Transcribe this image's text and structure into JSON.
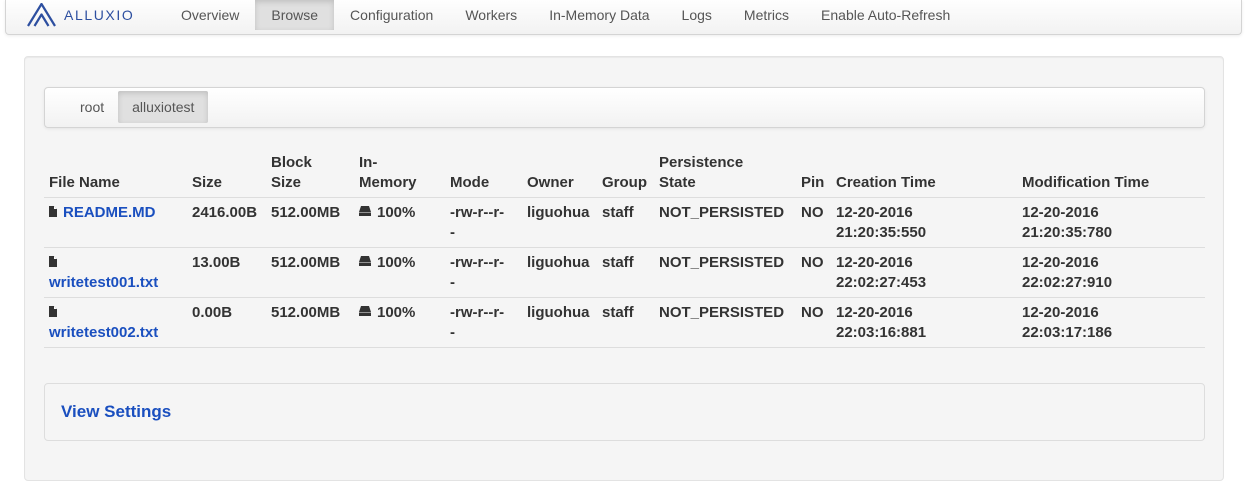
{
  "brand": {
    "name": "ALLUXIO"
  },
  "nav": {
    "items": [
      "Overview",
      "Browse",
      "Configuration",
      "Workers",
      "In-Memory Data",
      "Logs",
      "Metrics",
      "Enable Auto-Refresh"
    ],
    "active": "Browse"
  },
  "breadcrumbs": [
    "root",
    "alluxiotest"
  ],
  "table": {
    "headers": {
      "file_name": "File Name",
      "size": "Size",
      "block_size_1": "Block",
      "block_size_2": "Size",
      "in_memory_1": "In-",
      "in_memory_2": "Memory",
      "mode": "Mode",
      "owner": "Owner",
      "group": "Group",
      "persistence_1": "Persistence",
      "persistence_2": "State",
      "pin": "Pin",
      "creation_time": "Creation Time",
      "modification_time": "Modification Time"
    },
    "rows": [
      {
        "name": "README.MD",
        "size": "2416.00B",
        "block_size": "512.00MB",
        "in_memory": "100%",
        "mode_1": "-rw-r--r-",
        "mode_2": "-",
        "owner": "liguohua",
        "group": "staff",
        "persistence": "NOT_PERSISTED",
        "pin": "NO",
        "created_date": "12-20-2016",
        "created_time": "21:20:35:550",
        "modified_date": "12-20-2016",
        "modified_time": "21:20:35:780"
      },
      {
        "name": "writetest001.txt",
        "size": "13.00B",
        "block_size": "512.00MB",
        "in_memory": "100%",
        "mode_1": "-rw-r--r-",
        "mode_2": "-",
        "owner": "liguohua",
        "group": "staff",
        "persistence": "NOT_PERSISTED",
        "pin": "NO",
        "created_date": "12-20-2016",
        "created_time": "22:02:27:453",
        "modified_date": "12-20-2016",
        "modified_time": "22:02:27:910"
      },
      {
        "name": "writetest002.txt",
        "size": "0.00B",
        "block_size": "512.00MB",
        "in_memory": "100%",
        "mode_1": "-rw-r--r-",
        "mode_2": "-",
        "owner": "liguohua",
        "group": "staff",
        "persistence": "NOT_PERSISTED",
        "pin": "NO",
        "created_date": "12-20-2016",
        "created_time": "22:03:16:881",
        "modified_date": "12-20-2016",
        "modified_time": "22:03:17:186"
      }
    ]
  },
  "settings": {
    "link_label": "View Settings"
  },
  "icons": {
    "file": "file-icon",
    "in_memory": "hdd-icon",
    "logo": "alluxio-logo-icon"
  },
  "colors": {
    "link": "#1a4fbf",
    "brand": "#2d4fa0"
  }
}
